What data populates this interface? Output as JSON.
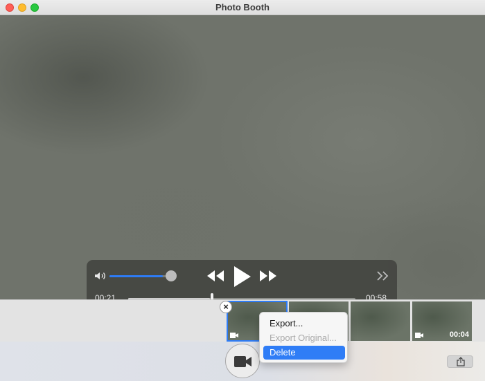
{
  "window": {
    "title": "Photo Booth"
  },
  "player": {
    "elapsed": "00:21",
    "total": "00:58",
    "volume": 0.85,
    "progress": 0.36
  },
  "thumbnails": [
    {
      "type": "video",
      "duration": "",
      "selected": true
    },
    {
      "type": "video",
      "duration": "",
      "selected": false
    },
    {
      "type": "video",
      "duration": "",
      "selected": false
    },
    {
      "type": "video",
      "duration": "00:04",
      "selected": false
    }
  ],
  "context_menu": {
    "items": [
      {
        "label": "Export...",
        "enabled": true
      },
      {
        "label": "Export Original...",
        "enabled": false
      },
      {
        "label": "Delete",
        "enabled": true,
        "highlighted": true
      }
    ]
  },
  "icons": {
    "close": "close-button-icon",
    "minimize": "minimize-icon",
    "maximize": "maximize-icon",
    "volume": "speaker-icon",
    "rewind": "rewind-icon",
    "play": "play-icon",
    "forward": "fast-forward-icon",
    "skip": "skip-chevrons-icon",
    "record": "video-camera-icon",
    "share": "share-icon",
    "delete": "delete-x-icon"
  },
  "colors": {
    "accent": "#2e7cf6",
    "highlight": "#2f7df6"
  }
}
